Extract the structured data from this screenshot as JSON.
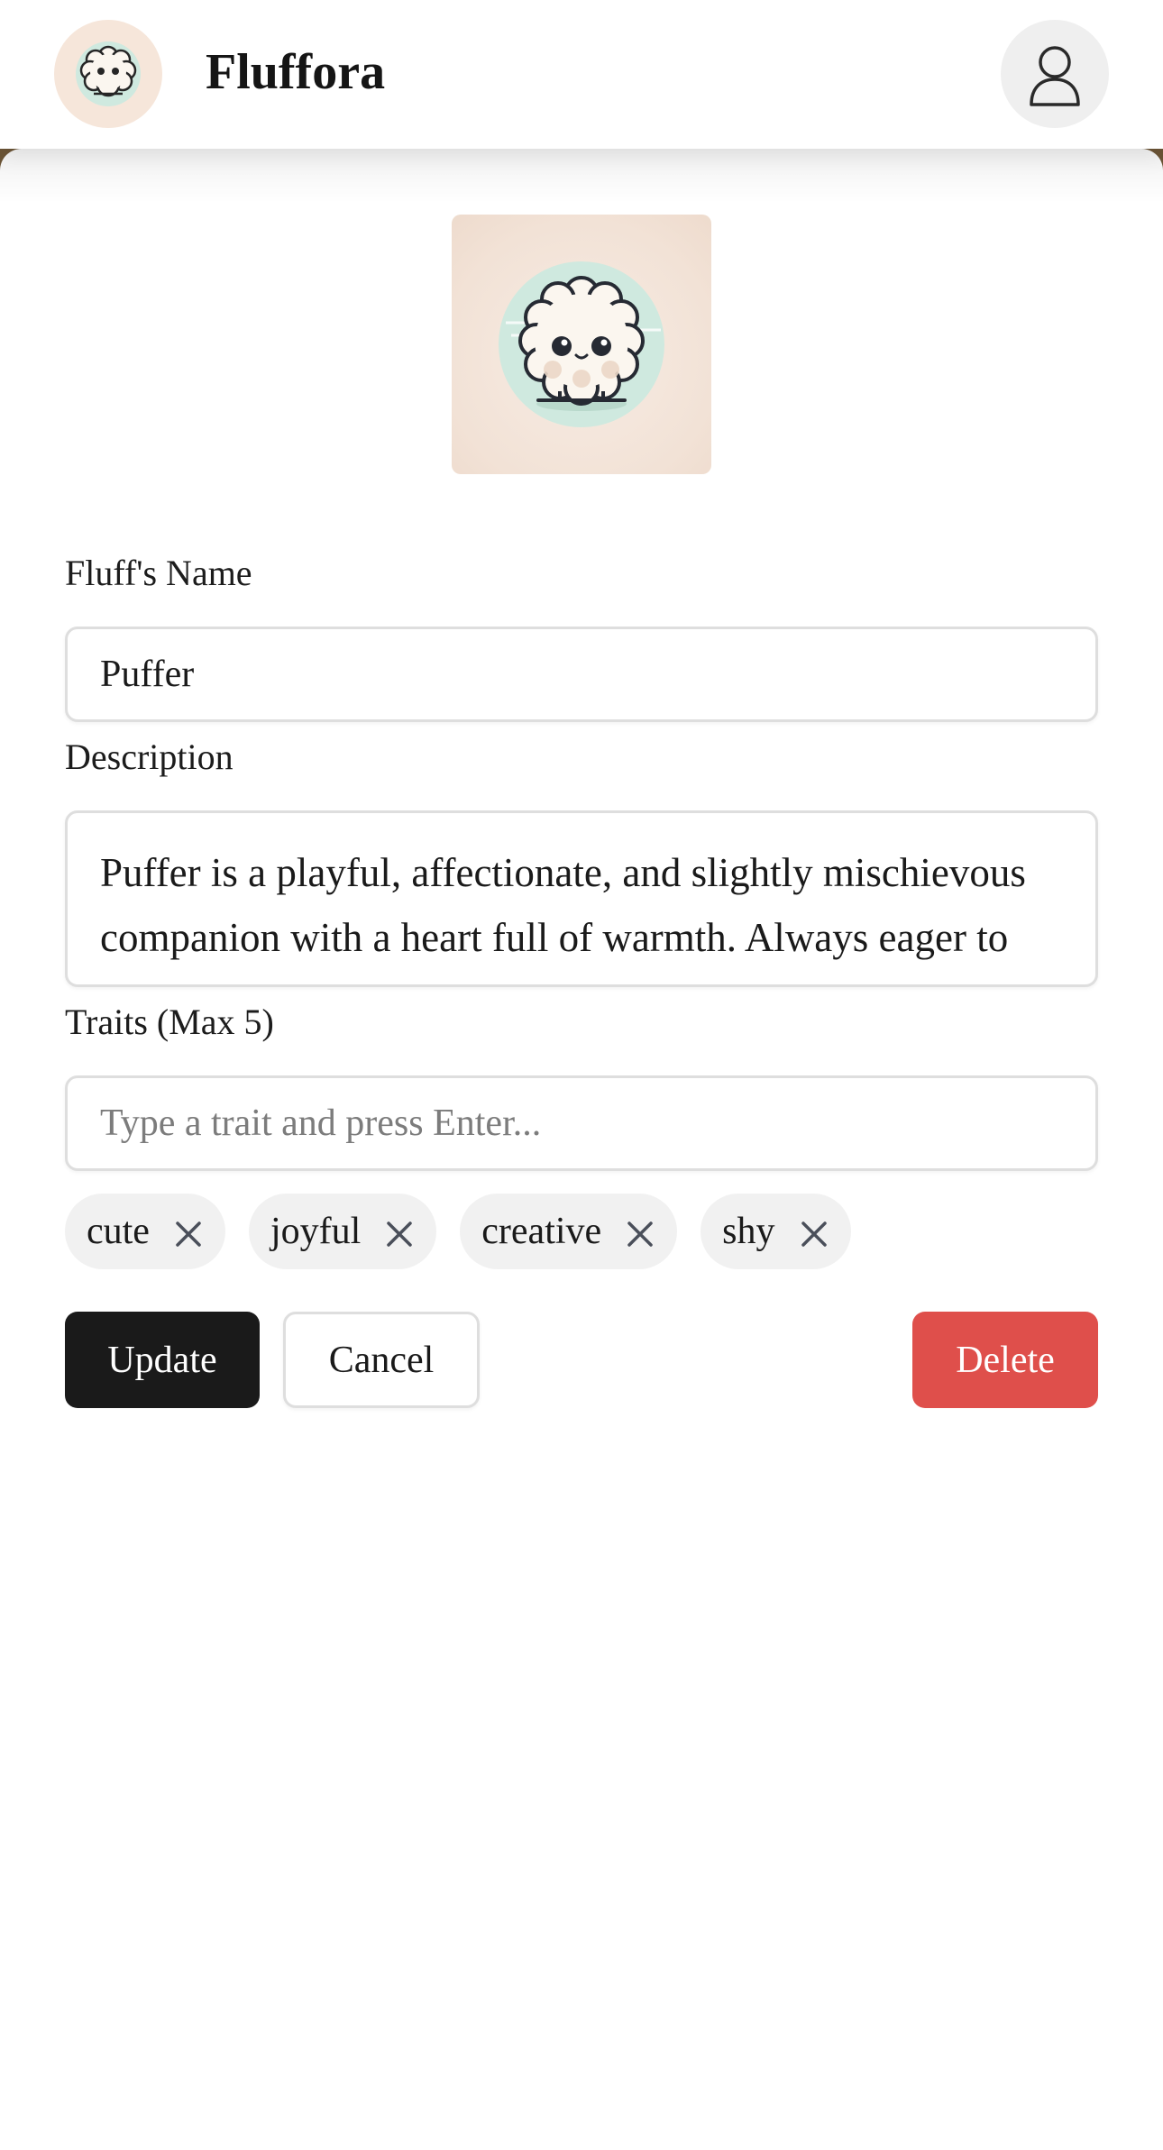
{
  "header": {
    "app_title": "Fluffora",
    "logo_icon": "fluff-mascot-icon",
    "profile_icon": "user-profile-icon"
  },
  "form": {
    "image_alt": "fluff-character-image",
    "name_label": "Fluff's Name",
    "name_value": "Puffer",
    "description_label": "Description",
    "description_value": "Puffer is a playful, affectionate, and slightly mischievous companion with a heart full of warmth. Always eager to play, Puffer loves to explore the",
    "traits_label": "Traits (Max 5)",
    "traits_placeholder": "Type a trait and press Enter...",
    "traits": [
      "cute",
      "joyful",
      "creative",
      "shy"
    ]
  },
  "actions": {
    "update_label": "Update",
    "cancel_label": "Cancel",
    "delete_label": "Delete"
  },
  "colors": {
    "primary": "#1a1a1a",
    "danger": "#df4f4b",
    "chip_bg": "#f1f1f1",
    "accent_mint": "#cfe9df",
    "backdrop": "#6b5436"
  }
}
